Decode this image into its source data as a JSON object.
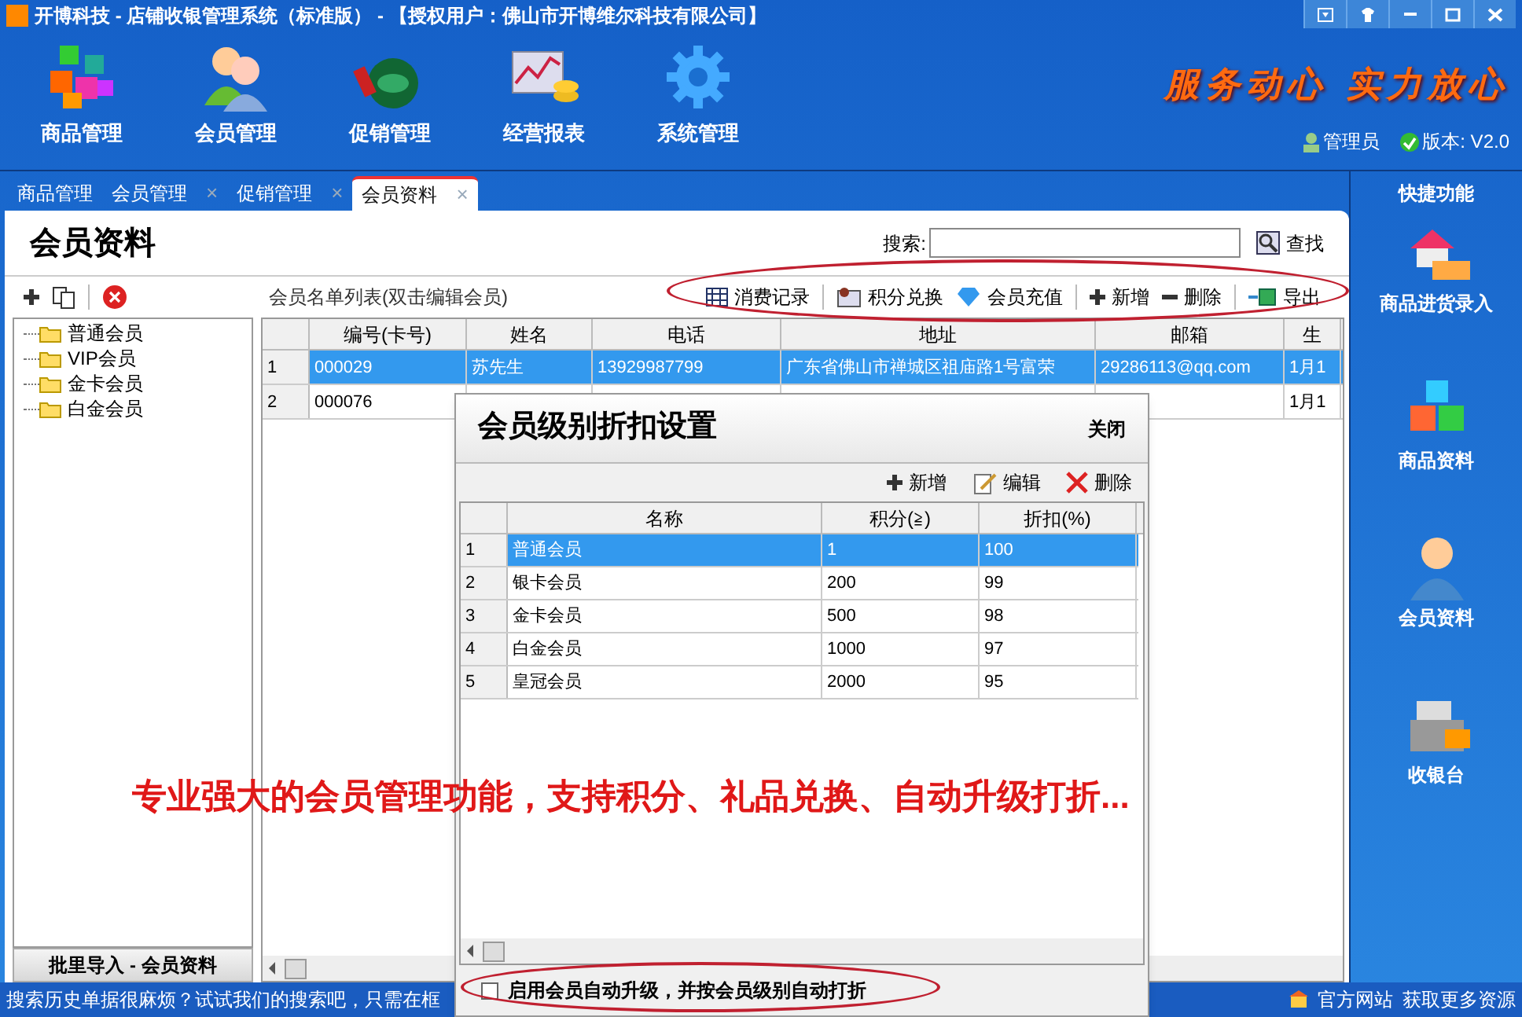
{
  "window": {
    "title": "开博科技 - 店铺收银管理系统（标准版） - 【授权用户：佛山市开博维尔科技有限公司】"
  },
  "nav": [
    {
      "label": "商品管理"
    },
    {
      "label": "会员管理"
    },
    {
      "label": "促销管理"
    },
    {
      "label": "经营报表"
    },
    {
      "label": "系统管理"
    }
  ],
  "slogan": "服务动心 实力放心",
  "user": "管理员",
  "version": "版本: V2.0",
  "tabs": [
    {
      "label": "商品管理",
      "selected": false
    },
    {
      "label": "会员管理",
      "close": "×",
      "selected": false
    },
    {
      "label": "促销管理",
      "close": "×",
      "selected": false
    },
    {
      "label": "会员资料",
      "close": "×",
      "selected": true
    }
  ],
  "page_title": "会员资料",
  "search": {
    "label": "搜索:",
    "button": "查找"
  },
  "list_caption": "会员名单列表(双击编辑会员)",
  "toolbar": [
    {
      "label": "消费记录"
    },
    {
      "label": "积分兑换"
    },
    {
      "label": "会员充值"
    },
    {
      "label": "新增"
    },
    {
      "label": "删除"
    },
    {
      "label": "导出"
    }
  ],
  "tree": [
    {
      "label": "普通会员"
    },
    {
      "label": "VIP会员"
    },
    {
      "label": "金卡会员"
    },
    {
      "label": "白金会员"
    }
  ],
  "import_button": "批里导入 - 会员资料",
  "table": {
    "columns": [
      "编号(卡号)",
      "姓名",
      "电话",
      "地址",
      "邮箱",
      "生"
    ],
    "rows": [
      {
        "num": "1",
        "selected": true,
        "cells": [
          "000029",
          "苏先生",
          "13929987799",
          "广东省佛山市禅城区祖庙路1号富荣",
          "29286113@qq.com",
          "1月1"
        ]
      },
      {
        "num": "2",
        "selected": false,
        "cells": [
          "000076",
          null,
          null,
          null,
          null,
          "1月1"
        ]
      }
    ]
  },
  "quick": {
    "title": "快捷功能",
    "items": [
      {
        "label": "商品进货录入"
      },
      {
        "label": "商品资料"
      },
      {
        "label": "会员资料"
      },
      {
        "label": "收银台"
      }
    ]
  },
  "status_bar": {
    "text": "搜索历史单据很麻烦？试试我们的搜索吧，只需在框",
    "links": [
      "官方网站",
      "获取更多资源"
    ]
  },
  "dialog": {
    "title": "会员级别折扣设置",
    "close": "关闭",
    "toolbar": [
      {
        "label": "新增"
      },
      {
        "label": "编辑"
      },
      {
        "label": "删除"
      }
    ],
    "columns": [
      "名称",
      "积分(≧)",
      "折扣(%)"
    ],
    "rows": [
      {
        "num": "1",
        "selected": true,
        "cells": [
          "普通会员",
          "1",
          "100"
        ]
      },
      {
        "num": "2",
        "selected": false,
        "cells": [
          "银卡会员",
          "200",
          "99"
        ]
      },
      {
        "num": "3",
        "selected": false,
        "cells": [
          "金卡会员",
          "500",
          "98"
        ]
      },
      {
        "num": "4",
        "selected": false,
        "cells": [
          "白金会员",
          "1000",
          "97"
        ]
      },
      {
        "num": "5",
        "selected": false,
        "cells": [
          "皇冠会员",
          "2000",
          "95"
        ]
      }
    ],
    "auto_upgrade": {
      "label": "启用会员自动升级，并按会员级别自动打折",
      "checked": false
    }
  },
  "promo_text": "专业强大的会员管理功能，支持积分、礼品兑换、自动升级打折..."
}
